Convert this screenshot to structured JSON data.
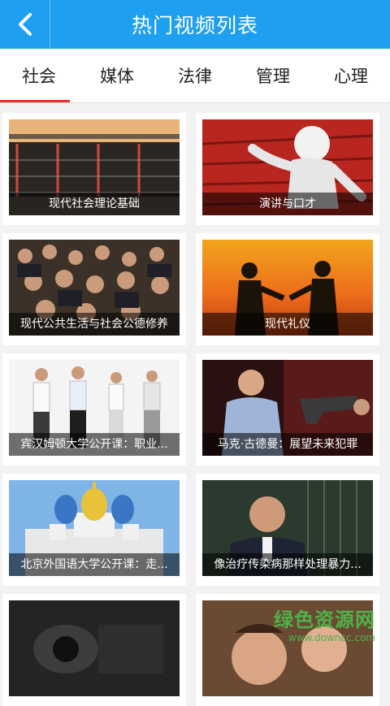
{
  "header": {
    "title": "热门视频列表",
    "back_icon": "chevron-left-icon"
  },
  "tabs": [
    "社会",
    "媒体",
    "法律",
    "管理",
    "心理"
  ],
  "active_tab": 0,
  "videos": [
    {
      "title": "现代社会理论基础"
    },
    {
      "title": "演讲与口才"
    },
    {
      "title": "现代公共生活与社会公德修养"
    },
    {
      "title": "现代礼仪"
    },
    {
      "title": "宾汉姆顿大学公开课：职业..."
    },
    {
      "title": "马克·古德曼：展望未来犯罪"
    },
    {
      "title": "北京外国语大学公开课：走..."
    },
    {
      "title": "像治疗传染病那样处理暴力..."
    },
    {
      "title": ""
    },
    {
      "title": ""
    }
  ],
  "watermark": {
    "main": "绿色资源网",
    "sub": "www.downcc.com"
  },
  "colors": {
    "header": "#1e9ff0",
    "active_tab_underline": "#ec2b2b",
    "background": "#f2f2f2"
  }
}
